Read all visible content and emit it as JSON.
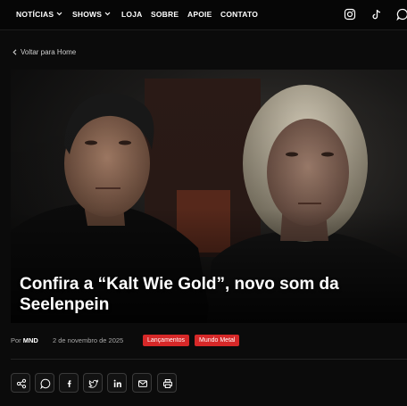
{
  "nav": {
    "items": [
      {
        "label": "NOTÍCIAS",
        "has_dropdown": true
      },
      {
        "label": "SHOWS",
        "has_dropdown": true
      },
      {
        "label": "LOJA",
        "has_dropdown": false
      },
      {
        "label": "SOBRE",
        "has_dropdown": false
      },
      {
        "label": "APOIE",
        "has_dropdown": false
      },
      {
        "label": "CONTATO",
        "has_dropdown": false
      }
    ],
    "social_icons": [
      "instagram-icon",
      "tiktok-icon",
      "whatsapp-icon"
    ]
  },
  "back_link": "Voltar para Home",
  "article": {
    "title": "Confira a “Kalt Wie Gold”, novo som da Seelenpein",
    "author_prefix": "Por",
    "author": "MND",
    "date": "2 de novembro de 2025",
    "tags": [
      "Lançamentos",
      "Mundo Metal"
    ]
  },
  "share_buttons": [
    "share-icon",
    "whatsapp-icon",
    "facebook-icon",
    "twitter-icon",
    "linkedin-icon",
    "email-icon",
    "print-icon"
  ],
  "colors": {
    "background": "#0b0b0b",
    "tag_red": "#d62828",
    "text": "#ffffff",
    "muted": "#a8a8a8"
  }
}
